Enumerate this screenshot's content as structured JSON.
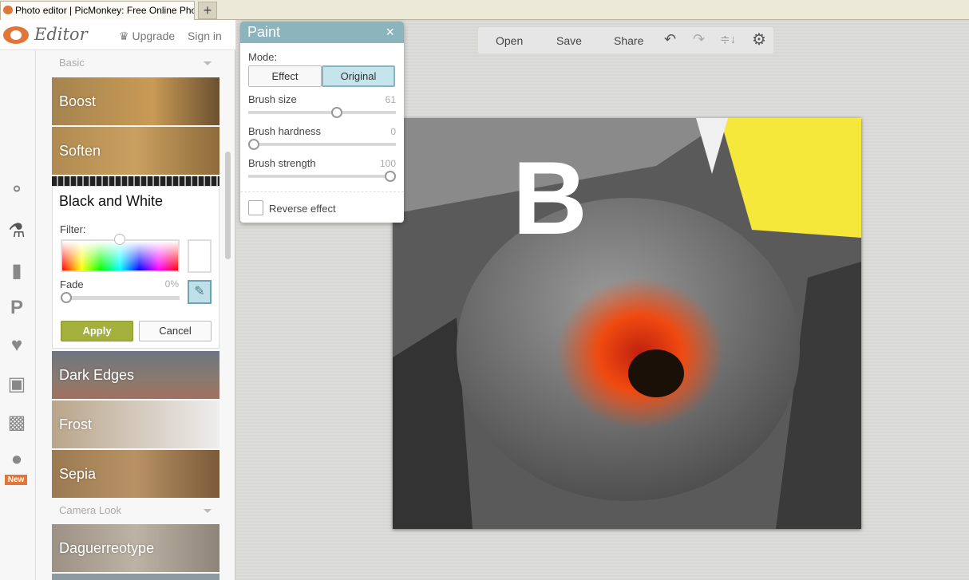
{
  "browser": {
    "tab_title": "Photo editor | PicMonkey: Free Online Photo...",
    "new_tab": "+"
  },
  "header": {
    "app": "Editor",
    "upgrade": "Upgrade",
    "signin": "Sign in"
  },
  "nav": {
    "icons": [
      "basic-edits-icon",
      "effects-icon",
      "touch-up-icon",
      "text-icon",
      "overlays-icon",
      "frames-icon",
      "textures-icon",
      "themes-icon"
    ],
    "new_badge": "New"
  },
  "effects": {
    "section_basic": "Basic",
    "items_top": [
      "Boost",
      "Soften"
    ],
    "bw": {
      "title": "Black and White",
      "filter_label": "Filter:",
      "fade_label": "Fade",
      "fade_value": "0%",
      "fade_fraction": 0,
      "apply": "Apply",
      "cancel": "Cancel"
    },
    "items_mid": [
      "Dark Edges",
      "Frost",
      "Sepia"
    ],
    "section_camera": "Camera Look",
    "items_camera": [
      "Daguerreotype"
    ]
  },
  "toolbar": {
    "open": "Open",
    "save": "Save",
    "share": "Share"
  },
  "paint": {
    "title": "Paint",
    "close": "×",
    "mode_label": "Mode:",
    "mode_effect": "Effect",
    "mode_original": "Original",
    "mode_selected": "Original",
    "brush_size_label": "Brush size",
    "brush_size": 61,
    "brush_hardness_label": "Brush hardness",
    "brush_hardness": 0,
    "brush_strength_label": "Brush strength",
    "brush_strength": 100,
    "reverse_label": "Reverse effect",
    "reverse_checked": false
  },
  "colors": {
    "accent": "#8cb4bd",
    "apply": "#a4b03c",
    "brand": "#e0763a"
  }
}
